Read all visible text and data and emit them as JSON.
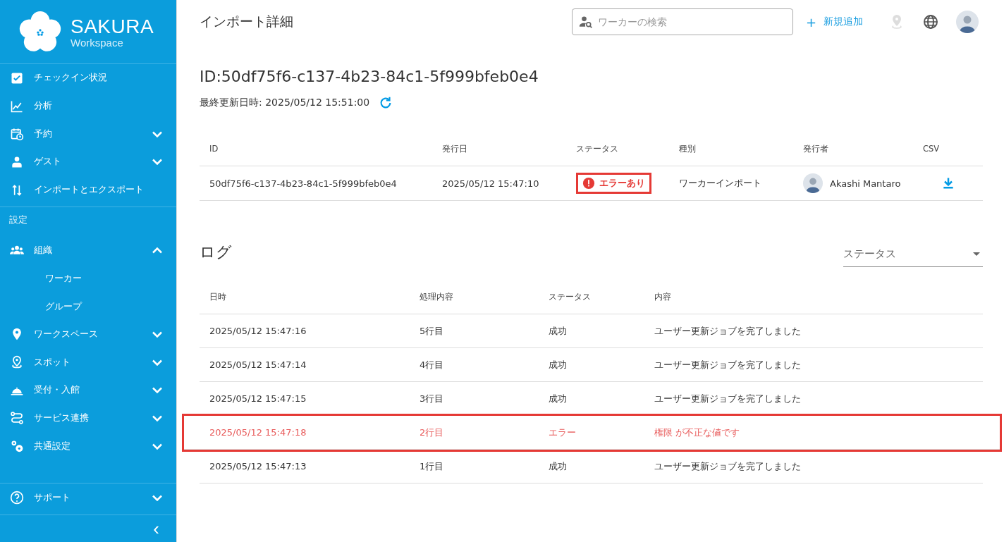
{
  "brand": {
    "name": "SAKURA",
    "sub": "Workspace"
  },
  "sidebar": {
    "items": [
      {
        "label": "チェックイン状況"
      },
      {
        "label": "分析"
      },
      {
        "label": "予約",
        "expanded": false
      },
      {
        "label": "ゲスト",
        "expanded": false
      },
      {
        "label": "インポートとエクスポート"
      }
    ],
    "section": "設定",
    "settings": [
      {
        "label": "組織",
        "expanded": true,
        "children": [
          {
            "label": "ワーカー"
          },
          {
            "label": "グループ"
          }
        ]
      },
      {
        "label": "ワークスペース",
        "expanded": false
      },
      {
        "label": "スポット",
        "expanded": false
      },
      {
        "label": "受付・入館",
        "expanded": false
      },
      {
        "label": "サービス連携",
        "expanded": false
      },
      {
        "label": "共通設定",
        "expanded": false
      }
    ],
    "support": {
      "label": "サポート",
      "expanded": false
    },
    "collapse": "‹"
  },
  "header": {
    "title": "インポート詳細",
    "search": {
      "placeholder": "ワーカーの検索"
    },
    "add": {
      "icon": "+",
      "label": "新規追加"
    }
  },
  "detail": {
    "title": "ID:50df75f6-c137-4b23-84c1-5f999bfeb0e4",
    "updated": "最終更新日時: 2025/05/12 15:51:00",
    "table": {
      "columns": [
        "ID",
        "発行日",
        "ステータス",
        "種別",
        "発行者",
        "CSV"
      ],
      "row": {
        "id": "50df75f6-c137-4b23-84c1-5f999bfeb0e4",
        "date": "2025/05/12 15:47:10",
        "status": "エラーあり",
        "status_error": true,
        "highlighted": true,
        "type": "ワーカーインポート",
        "issuer": "Akashi Mantaro"
      }
    }
  },
  "log": {
    "title": "ログ",
    "filter": {
      "placeholder": "ステータス"
    },
    "columns": [
      "日時",
      "処理内容",
      "ステータス",
      "内容"
    ],
    "rows": [
      {
        "time": "2025/05/12 15:47:16",
        "step": "5行目",
        "status": "成功",
        "message": "ユーザー更新ジョブを完了しました",
        "error": false,
        "highlighted": false
      },
      {
        "time": "2025/05/12 15:47:14",
        "step": "4行目",
        "status": "成功",
        "message": "ユーザー更新ジョブを完了しました",
        "error": false,
        "highlighted": false
      },
      {
        "time": "2025/05/12 15:47:15",
        "step": "3行目",
        "status": "成功",
        "message": "ユーザー更新ジョブを完了しました",
        "error": false,
        "highlighted": false
      },
      {
        "time": "2025/05/12 15:47:18",
        "step": "2行目",
        "status": "エラー",
        "message": "権限 が不正な値です",
        "error": true,
        "highlighted": true
      },
      {
        "time": "2025/05/12 15:47:13",
        "step": "1行目",
        "status": "成功",
        "message": "ユーザー更新ジョブを完了しました",
        "error": false,
        "highlighted": false
      }
    ]
  }
}
